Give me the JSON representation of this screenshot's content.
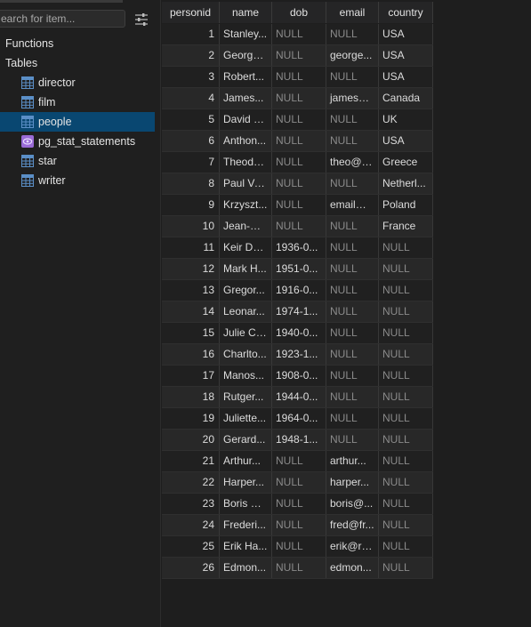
{
  "sidebar": {
    "search": {
      "placeholder": "earch for item...",
      "value": ""
    },
    "filter_icon": "sliders-icon",
    "sections": {
      "functions": "Functions",
      "tables": "Tables"
    },
    "tables": [
      {
        "label": "director",
        "icon": "table-icon"
      },
      {
        "label": "film",
        "icon": "table-icon"
      },
      {
        "label": "people",
        "icon": "table-icon",
        "selected": true
      },
      {
        "label": "pg_stat_statements",
        "icon": "view-icon"
      },
      {
        "label": "star",
        "icon": "table-icon"
      },
      {
        "label": "writer",
        "icon": "table-icon"
      }
    ]
  },
  "colors": {
    "selection": "#094771",
    "table_icon": "#5b8fc7",
    "view_icon": "#9a6bd6",
    "null_text": "#8a8a8a"
  },
  "grid": {
    "columns": [
      "personid",
      "name",
      "dob",
      "email",
      "country"
    ],
    "rows": [
      [
        "1",
        "Stanley...",
        "NULL",
        "NULL",
        "USA"
      ],
      [
        "2",
        "George...",
        "NULL",
        "george...",
        "USA"
      ],
      [
        "3",
        "Robert...",
        "NULL",
        "NULL",
        "USA"
      ],
      [
        "4",
        "James...",
        "NULL",
        "james@...",
        "Canada"
      ],
      [
        "5",
        "David L...",
        "NULL",
        "NULL",
        "UK"
      ],
      [
        "6",
        "Anthon...",
        "NULL",
        "NULL",
        "USA"
      ],
      [
        "7",
        "Theodo...",
        "NULL",
        "theo@a...",
        "Greece"
      ],
      [
        "8",
        "Paul Ve...",
        "NULL",
        "NULL",
        "Netherl..."
      ],
      [
        "9",
        "Krzyszt...",
        "NULL",
        "email@...",
        "Poland"
      ],
      [
        "10",
        "Jean-Pa...",
        "NULL",
        "NULL",
        "France"
      ],
      [
        "11",
        "Keir Dul...",
        "1936-0...",
        "NULL",
        "NULL"
      ],
      [
        "12",
        "Mark H...",
        "1951-0...",
        "NULL",
        "NULL"
      ],
      [
        "13",
        "Gregor...",
        "1916-0...",
        "NULL",
        "NULL"
      ],
      [
        "14",
        "Leonar...",
        "1974-1...",
        "NULL",
        "NULL"
      ],
      [
        "15",
        "Julie Ch...",
        "1940-0...",
        "NULL",
        "NULL"
      ],
      [
        "16",
        "Charlto...",
        "1923-1...",
        "NULL",
        "NULL"
      ],
      [
        "17",
        "Manos...",
        "1908-0...",
        "NULL",
        "NULL"
      ],
      [
        "18",
        "Rutger...",
        "1944-0...",
        "NULL",
        "NULL"
      ],
      [
        "19",
        "Juliette...",
        "1964-0...",
        "NULL",
        "NULL"
      ],
      [
        "20",
        "Gerard...",
        "1948-1...",
        "NULL",
        "NULL"
      ],
      [
        "21",
        "Arthur...",
        "NULL",
        "arthur...",
        "NULL"
      ],
      [
        "22",
        "Harper...",
        "NULL",
        "harper...",
        "NULL"
      ],
      [
        "23",
        "Boris Pa...",
        "NULL",
        "boris@...",
        "NULL"
      ],
      [
        "24",
        "Frederi...",
        "NULL",
        "fred@fr...",
        "NULL"
      ],
      [
        "25",
        "Erik Ha...",
        "NULL",
        "erik@ro...",
        "NULL"
      ],
      [
        "26",
        "Edmon...",
        "NULL",
        "edmon...",
        "NULL"
      ]
    ]
  }
}
